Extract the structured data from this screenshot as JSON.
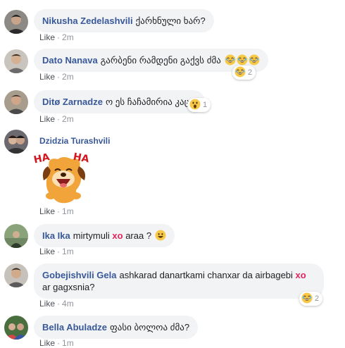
{
  "comments": [
    {
      "author": "Nikusha Zedelashvili",
      "text": "ქარხნული ხარ?",
      "like_label": "Like",
      "time": "2m"
    },
    {
      "author": "Dato Nanava",
      "text": "გარბენი რამდენი გაქვს ძმა",
      "like_label": "Like",
      "time": "2m",
      "reaction_emoji": "laughing-face-icon",
      "reaction_count": "2"
    },
    {
      "author": "Ditø Zarnadze",
      "text": "ო ეს ჩაჩამირია კაცო",
      "like_label": "Like",
      "time": "2m",
      "reaction_emoji": "wow-face-icon",
      "reaction_count": "1"
    },
    {
      "author": "Dzidzia Turashvili",
      "sticker": "dog-haha-sticker",
      "sticker_text_1": "HA",
      "sticker_text_2": "HA",
      "like_label": "Like",
      "time": "1m"
    },
    {
      "author": "Ika Ika",
      "text_before": "mirtymuli",
      "text_highlight": "xo",
      "text_after": "araa ?",
      "like_label": "Like",
      "time": "1m"
    },
    {
      "author": "Gobejishvili Gela",
      "text_before": "ashkarad danartkami chanxar da airbagebi",
      "text_highlight": "xo",
      "text_after": "ar gagxsnia?",
      "like_label": "Like",
      "time": "4m",
      "reaction_emoji": "laughing-face-icon",
      "reaction_count": "2"
    },
    {
      "author": "Bella Abuladze",
      "text": "ფასი ბოლოა ძმა?",
      "like_label": "Like",
      "time": "1m"
    }
  ],
  "meta_separator": "·",
  "colors": {
    "author": "#385898",
    "bubble": "#f2f3f5",
    "meta": "#90949c",
    "highlight": "#e0245e"
  }
}
